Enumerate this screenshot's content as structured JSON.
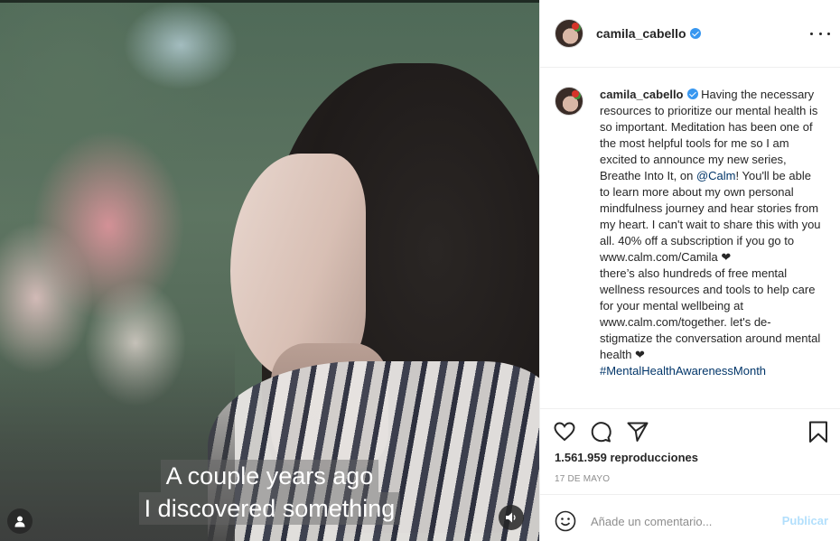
{
  "post": {
    "username": "camila_cabello",
    "verified": true,
    "caption_intro": "Having the necessary resources to prioritize our mental health is so important. Meditation has been one of the most helpful tools for me so I am excited to announce my new series, Breathe Into It, on ",
    "caption_mention": "@Calm",
    "caption_after_mention": "! You'll be able to learn more about my own personal mindfulness journey and hear stories from my heart. I can't wait to share this with you all. 40% off a subscription if you go to www.calm.com/Camila ❤",
    "caption_line2": "there’s also hundreds of free mental wellness resources and tools to help care for your mental wellbeing at www.calm.com/together. let's de-stigmatize the conversation around mental health ❤",
    "caption_hashtag": "#MentalHealthAwarenessMonth",
    "views": "1.561.959 reproducciones",
    "date": "17 DE MAYO"
  },
  "video": {
    "subtitle_line1": "A couple years ago",
    "subtitle_line2": "I discovered something"
  },
  "comment_box": {
    "placeholder": "Añade un comentario...",
    "post_label": "Publicar"
  },
  "icons": {
    "user_tag": "user-icon",
    "mute": "speaker-icon",
    "like": "heart-icon",
    "comment": "comment-icon",
    "share": "send-icon",
    "save": "bookmark-icon",
    "emoji": "smiley-icon",
    "more": "more-options-icon"
  },
  "colors": {
    "link": "#003569",
    "verified": "#3897f0",
    "post_disabled": "#b2dffc",
    "secondary_text": "#8e8e8e"
  }
}
